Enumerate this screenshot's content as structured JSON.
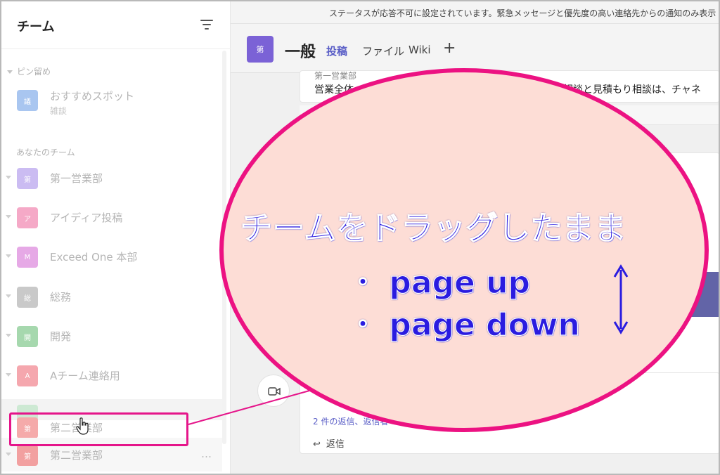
{
  "sidebar": {
    "title": "チーム",
    "sections": {
      "pinned": "ピン留め",
      "yours": "あなたのチーム"
    },
    "pinned_team": {
      "avatar": "議",
      "name": "おすすめスポット",
      "subtitle": "雑談",
      "color": "#a9c6f0"
    },
    "teams": [
      {
        "avatar": "第",
        "name": "第一営業部",
        "color": "#cbbcf2"
      },
      {
        "avatar": "ア",
        "name": "アイディア投稿",
        "color": "#f5a9c7"
      },
      {
        "avatar": "M",
        "name": "Exceed One 本部",
        "color": "#e6a9e6"
      },
      {
        "avatar": "総",
        "name": "総務",
        "color": "#c9c9c9"
      },
      {
        "avatar": "開",
        "name": "開発",
        "color": "#a6d8ae"
      },
      {
        "avatar": "A",
        "name": "Aチーム連絡用",
        "color": "#f5a7ae"
      }
    ],
    "dragging_team": {
      "avatar": "第",
      "name": "第二営業部",
      "color": "#f5aaaa"
    },
    "last_team": {
      "avatar": "第",
      "name": "第二営業部",
      "more": "…",
      "color": "#f2a0a0"
    }
  },
  "main": {
    "banner": "ステータスが応答不可に設定されています。緊急メッセージと優先度の高い連絡先からの通知のみ表示",
    "channel": {
      "avatar": "第",
      "name": "一般",
      "tabs": [
        "投稿",
        "ファイル",
        "Wiki"
      ],
      "add": "+"
    },
    "post": {
      "author": "第一営業部",
      "body_left": "営業全体",
      "body_right": "件相談と見積もり相談は、チャネ"
    },
    "thread": {
      "reply_count": "2 件の返信、返信者",
      "reply": "返信"
    }
  },
  "callout": {
    "line1": "チームをドラッグしたまま",
    "line2": "・ page up",
    "line3": "・ page down"
  },
  "colors": {
    "accent": "#5b5fc7",
    "callout_border": "#ec1282",
    "callout_fill": "#fdddd6",
    "callout_text": "#2a1ce0"
  }
}
